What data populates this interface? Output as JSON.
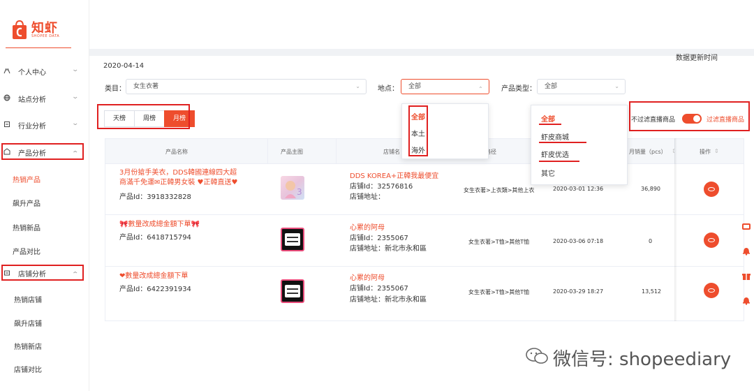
{
  "app": {
    "logo_cn": "知虾",
    "logo_en": "SHOPEE DATA",
    "brand_color": "#ee4d2d"
  },
  "sidebar": {
    "items": [
      {
        "label": "个人中心",
        "icon": "person-icon"
      },
      {
        "label": "站点分析",
        "icon": "globe-icon"
      },
      {
        "label": "行业分析",
        "icon": "industry-icon"
      },
      {
        "label": "产品分析",
        "icon": "box-icon"
      },
      {
        "label": "店铺分析",
        "icon": "store-icon"
      }
    ],
    "product_sub": [
      "热销产品",
      "飙升产品",
      "热销新品",
      "产品对比"
    ],
    "store_sub": [
      "热销店铺",
      "飙升店铺",
      "热销新店",
      "店铺对比"
    ]
  },
  "header": {
    "date": "2020-04-14",
    "update_time_label": "数据更新时间"
  },
  "filters": {
    "category_label": "类目：",
    "category_value": "女生衣著",
    "location_label": "地点：",
    "location_value": "全部",
    "product_type_label": "产品类型：",
    "product_type_value": "全部"
  },
  "period_tabs": [
    "天榜",
    "周榜",
    "月榜"
  ],
  "active_period": "月榜",
  "location_dropdown": [
    "全部",
    "本土",
    "海外"
  ],
  "type_dropdown": [
    "全部",
    "虾皮商城",
    "虾皮优选",
    "其它"
  ],
  "live_toggle": {
    "off_label": "不过滤直播商品",
    "on_label": "过滤直播商品",
    "state": "on"
  },
  "table": {
    "columns": [
      "产品名称",
      "产品主图",
      "店铺名",
      "类目路径",
      "上架时间",
      "月销量（pcs）",
      "操作"
    ],
    "col_shop_partial": "店铺名",
    "col_cat_partial": "类目路径",
    "col_sales_partial": "月销量（pcs）",
    "rows": [
      {
        "name": "3月份搶手美衣，DDS韓國連線四大超商滿千免運✉正韓男女裝 ♥正韓直送♥",
        "name_line1": "3月份搶手美衣，DDS韓國連線四大超",
        "name_line2": "商滿千免運✉正韓男女裝 ♥正韓直送♥",
        "product_id": "产品Id：3918332828",
        "shop_name": "DDS KOREA+正韓我最便宜",
        "shop_id": "店铺Id：32576816",
        "shop_addr": "店铺地址：",
        "category_path": "女生衣著>上衣類>其他上衣",
        "listed": "2020-03-01 12:36",
        "sales": "36,890"
      },
      {
        "name": "🎀數量改成總金額下單🎀",
        "product_id": "产品Id：6418715794",
        "shop_name": "心累的阿母",
        "shop_id": "店铺Id：2355067",
        "shop_addr": "店铺地址：新北市永和區",
        "category_path": "女生衣著>T恤>其他T恤",
        "listed": "2020-03-06 07:18",
        "sales": "0"
      },
      {
        "name": "❤數量改成總金額下單",
        "product_id": "产品Id：6422391934",
        "shop_name": "心累的阿母",
        "shop_id": "店铺Id：2355067",
        "shop_addr": "店铺地址：新北市永和區",
        "category_path": "女生衣著>T恤>其他T恤",
        "listed": "2020-03-29 18:27",
        "sales": "13,512"
      }
    ]
  },
  "watermark": "微信号: shopeediary"
}
